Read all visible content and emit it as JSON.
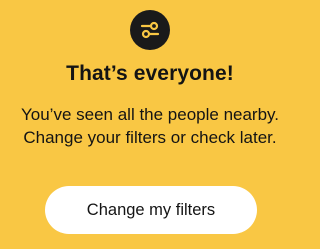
{
  "empty_state": {
    "icon": "filter-sliders-icon",
    "title": "That’s everyone!",
    "message_line1": "You’ve seen all the people nearby.",
    "message_line2": "Change your filters or check later.",
    "button_label": "Change my filters"
  },
  "colors": {
    "background": "#f9c744",
    "icon_circle": "#1a1a1a",
    "icon_stroke": "#f9c744",
    "text": "#141414",
    "button_bg": "#ffffff"
  }
}
